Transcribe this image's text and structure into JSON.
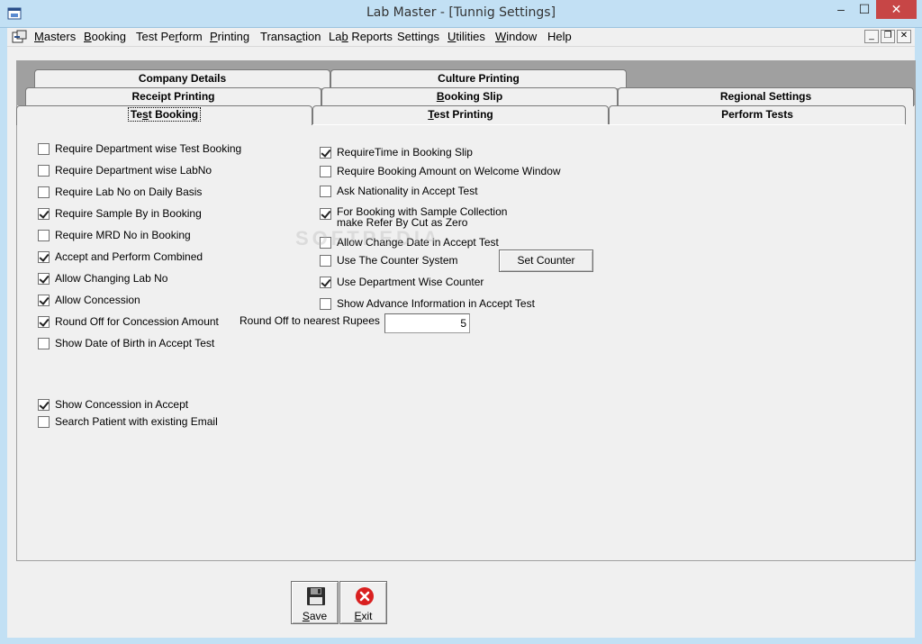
{
  "window": {
    "title": "Lab Master - [Tunnig Settings]",
    "min_glyph": "–",
    "max_glyph": "☐",
    "close_glyph": "✕"
  },
  "menu": {
    "items": [
      {
        "pre": "",
        "ul": "M",
        "post": "asters"
      },
      {
        "pre": "",
        "ul": "B",
        "post": "ooking"
      },
      {
        "pre": "Test Pe",
        "ul": "r",
        "post": "form"
      },
      {
        "pre": "",
        "ul": "P",
        "post": "rinting"
      },
      {
        "pre": "Transa",
        "ul": "c",
        "post": "tion"
      },
      {
        "pre": "La",
        "ul": "b",
        "post": " Reports"
      },
      {
        "pre": "Settings",
        "ul": "",
        "post": ""
      },
      {
        "pre": "",
        "ul": "U",
        "post": "tilities"
      },
      {
        "pre": "",
        "ul": "W",
        "post": "indow"
      },
      {
        "pre": "Help",
        "ul": "",
        "post": ""
      }
    ],
    "mdi_min": "_",
    "mdi_restore": "❐",
    "mdi_close": "✕"
  },
  "tabs": {
    "company_details": "Company Details",
    "culture_printing": "Culture Printing",
    "receipt_printing": "Receipt Printing",
    "booking_slip": {
      "pre": "",
      "ul": "B",
      "post": "ooking Slip"
    },
    "regional_settings": "Regional Settings",
    "test_booking": {
      "pre": "Te",
      "ul": "s",
      "post": "t Booking"
    },
    "test_printing": {
      "pre": "",
      "ul": "T",
      "post": "est Printing"
    },
    "perform_tests": "Perform Tests"
  },
  "left_options": [
    {
      "label": "Require Department wise Test Booking",
      "checked": false
    },
    {
      "label": "Require Department wise LabNo",
      "checked": false
    },
    {
      "label": "Require Lab No on Daily Basis",
      "checked": false
    },
    {
      "label": "Require Sample By in Booking",
      "checked": true
    },
    {
      "label": "Require MRD No in Booking",
      "checked": false
    },
    {
      "label": "Accept and Perform Combined",
      "checked": true
    },
    {
      "label": "Allow Changing Lab No",
      "checked": true
    },
    {
      "label": "Allow Concession",
      "checked": true
    },
    {
      "label": "Round Off for Concession Amount",
      "checked": true
    },
    {
      "label": "Show Date of Birth in Accept Test",
      "checked": false
    }
  ],
  "bottom_options": [
    {
      "label": "Show Concession in Accept",
      "checked": true
    },
    {
      "label": "Search Patient with existing Email",
      "checked": false
    }
  ],
  "right_options": [
    {
      "label": "RequireTime in Booking Slip",
      "checked": true
    },
    {
      "label": "Require Booking Amount on Welcome Window",
      "checked": false
    },
    {
      "label": "Ask Nationality in Accept Test",
      "checked": false
    },
    {
      "label": "For Booking with Sample Collection",
      "label2": "make Refer By Cut as Zero",
      "checked": true
    },
    {
      "label": "Allow Change Date in Accept Test",
      "checked": false
    },
    {
      "label": "Use The Counter System",
      "checked": false
    },
    {
      "label": "Use Department Wise Counter",
      "checked": true
    },
    {
      "label": "Show  Advance Information  in Accept Test",
      "checked": false
    }
  ],
  "set_counter_label": "Set Counter",
  "round_off": {
    "label": "Round Off to nearest Rupees",
    "value": "5"
  },
  "watermark": "SOFTPEDIA",
  "footer": {
    "save": {
      "ul": "S",
      "post": "ave"
    },
    "exit": {
      "ul": "E",
      "post": "xit"
    }
  },
  "colors": {
    "title_bar": "#c2e0f4",
    "close_button": "#c74646",
    "tab_strip_bg": "#a0a0a0",
    "exit_icon": "#d92020"
  }
}
